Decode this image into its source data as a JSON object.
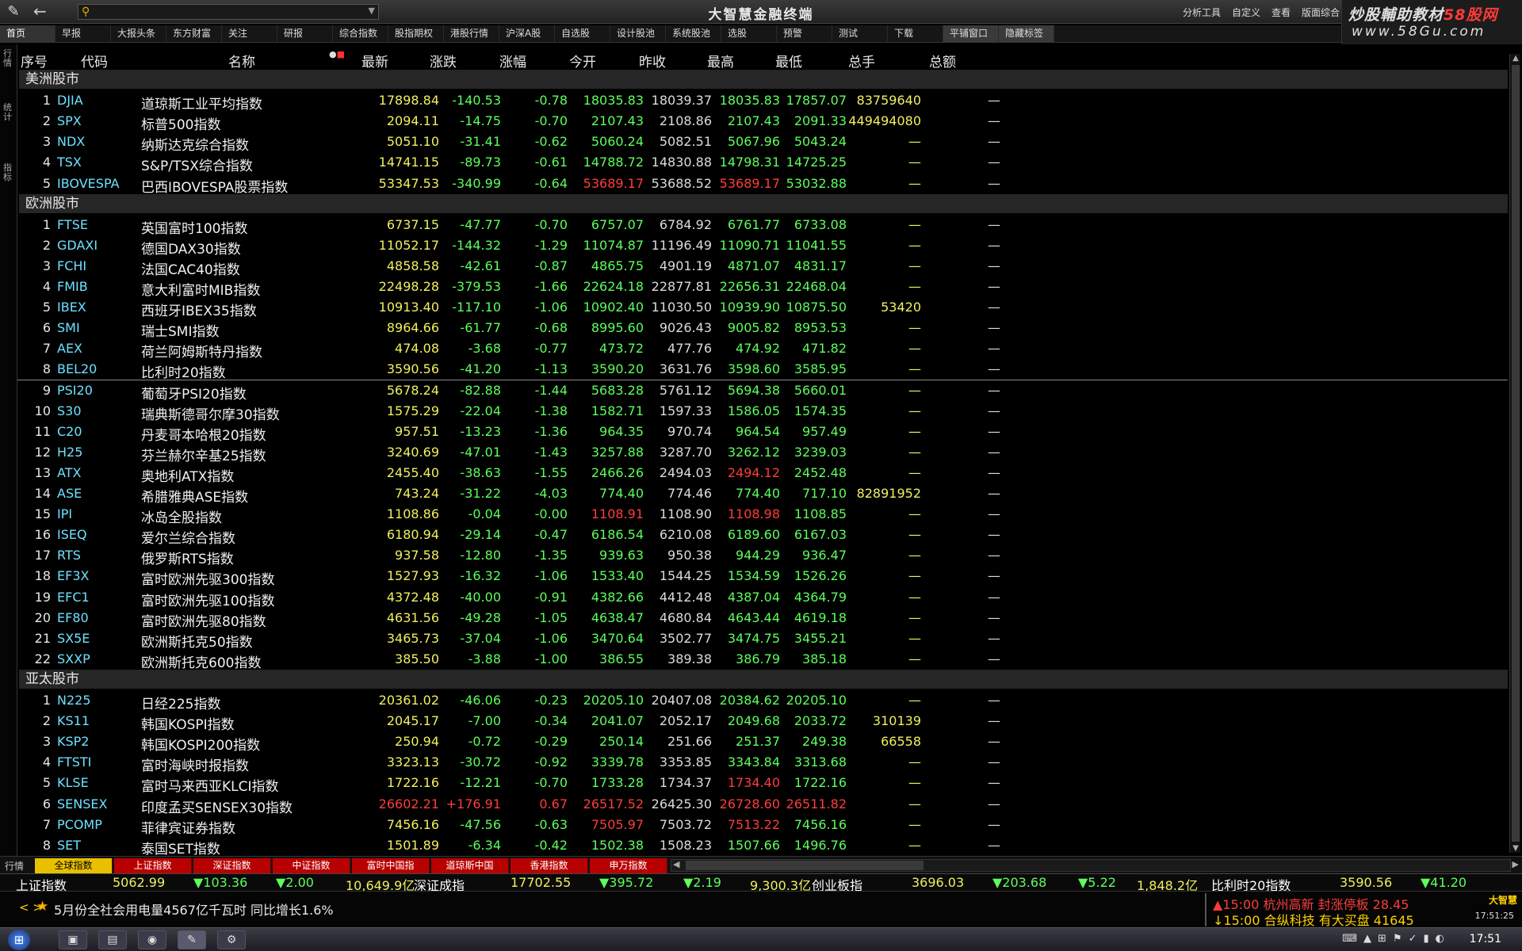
{
  "app": {
    "title": "大智慧金融终端",
    "menu": [
      "分析工具",
      "自定义",
      "查看",
      "版面综合"
    ],
    "watermark_line1": "炒股輔助教材",
    "watermark_brand": "58股网",
    "watermark_line2": "www.58Gu.com"
  },
  "tabs": [
    "首页",
    "早报",
    "大报头条",
    "东方财富",
    "关注",
    "研报",
    "综合指数",
    "股指期权",
    "港股行情",
    "沪深A股",
    "自选股",
    "设计股池",
    "系统股池",
    "选股",
    "预警",
    "测试",
    "下载",
    "平铺窗口",
    "隐藏标签"
  ],
  "left_strip": [
    "行情",
    "统计",
    "指标"
  ],
  "columns": [
    "序号",
    "代码",
    "名称",
    "最新",
    "涨跌",
    "涨幅",
    "今开",
    "昨收",
    "最高",
    "最低",
    "总手",
    "总额"
  ],
  "sections": [
    {
      "title": "美洲股市",
      "rows": [
        {
          "no": "1",
          "code": "DJIA",
          "name": "道琼斯工业平均指数",
          "last": "17898.84",
          "chg": "-140.53",
          "pct": "-0.78",
          "open": "18035.83",
          "prev": "18039.37",
          "high": "18035.83",
          "low": "17857.07",
          "vol": "83759640",
          "amt": "—"
        },
        {
          "no": "2",
          "code": "SPX",
          "name": "标普500指数",
          "last": "2094.11",
          "chg": "-14.75",
          "pct": "-0.70",
          "open": "2107.43",
          "prev": "2108.86",
          "high": "2107.43",
          "low": "2091.33",
          "vol": "449494080",
          "amt": "—"
        },
        {
          "no": "3",
          "code": "NDX",
          "name": "纳斯达克综合指数",
          "last": "5051.10",
          "chg": "-31.41",
          "pct": "-0.62",
          "open": "5060.24",
          "prev": "5082.51",
          "high": "5067.96",
          "low": "5043.24",
          "vol": "—",
          "amt": "—"
        },
        {
          "no": "4",
          "code": "TSX",
          "name": "S&P/TSX综合指数",
          "last": "14741.15",
          "chg": "-89.73",
          "pct": "-0.61",
          "open": "14788.72",
          "prev": "14830.88",
          "high": "14798.31",
          "low": "14725.25",
          "vol": "—",
          "amt": "—"
        },
        {
          "no": "5",
          "code": "IBOVESPA",
          "name": "巴西IBOVESPA股票指数",
          "last": "53347.53",
          "chg": "-340.99",
          "pct": "-0.64",
          "open": "53689.17",
          "prev": "53688.52",
          "high": "53689.17",
          "low": "53032.88",
          "vol": "—",
          "amt": "—",
          "open_up": true,
          "high_up": true
        }
      ]
    },
    {
      "title": "欧洲股市",
      "rows": [
        {
          "no": "1",
          "code": "FTSE",
          "name": "英国富时100指数",
          "last": "6737.15",
          "chg": "-47.77",
          "pct": "-0.70",
          "open": "6757.07",
          "prev": "6784.92",
          "high": "6761.77",
          "low": "6733.08",
          "vol": "—",
          "amt": "—"
        },
        {
          "no": "2",
          "code": "GDAXI",
          "name": "德国DAX30指数",
          "last": "11052.17",
          "chg": "-144.32",
          "pct": "-1.29",
          "open": "11074.87",
          "prev": "11196.49",
          "high": "11090.71",
          "low": "11041.55",
          "vol": "—",
          "amt": "—"
        },
        {
          "no": "3",
          "code": "FCHI",
          "name": "法国CAC40指数",
          "last": "4858.58",
          "chg": "-42.61",
          "pct": "-0.87",
          "open": "4865.75",
          "prev": "4901.19",
          "high": "4871.07",
          "low": "4831.17",
          "vol": "—",
          "amt": "—"
        },
        {
          "no": "4",
          "code": "FMIB",
          "name": "意大利富时MIB指数",
          "last": "22498.28",
          "chg": "-379.53",
          "pct": "-1.66",
          "open": "22624.18",
          "prev": "22877.81",
          "high": "22656.31",
          "low": "22468.04",
          "vol": "—",
          "amt": "—"
        },
        {
          "no": "5",
          "code": "IBEX",
          "name": "西班牙IBEX35指数",
          "last": "10913.40",
          "chg": "-117.10",
          "pct": "-1.06",
          "open": "10902.40",
          "prev": "11030.50",
          "high": "10939.90",
          "low": "10875.50",
          "vol": "53420",
          "amt": "—"
        },
        {
          "no": "6",
          "code": "SMI",
          "name": "瑞士SMI指数",
          "last": "8964.66",
          "chg": "-61.77",
          "pct": "-0.68",
          "open": "8995.60",
          "prev": "9026.43",
          "high": "9005.82",
          "low": "8953.53",
          "vol": "—",
          "amt": "—"
        },
        {
          "no": "7",
          "code": "AEX",
          "name": "荷兰阿姆斯特丹指数",
          "last": "474.08",
          "chg": "-3.68",
          "pct": "-0.77",
          "open": "473.72",
          "prev": "477.76",
          "high": "474.92",
          "low": "471.82",
          "vol": "—",
          "amt": "—"
        },
        {
          "no": "8",
          "code": "BEL20",
          "name": "比利时20指数",
          "last": "3590.56",
          "chg": "-41.20",
          "pct": "-1.13",
          "open": "3590.20",
          "prev": "3631.76",
          "high": "3598.60",
          "low": "3585.95",
          "vol": "—",
          "amt": "—"
        },
        {
          "no": "9",
          "code": "PSI20",
          "name": "葡萄牙PSI20指数",
          "last": "5678.24",
          "chg": "-82.88",
          "pct": "-1.44",
          "open": "5683.28",
          "prev": "5761.12",
          "high": "5694.38",
          "low": "5660.01",
          "vol": "—",
          "amt": "—"
        },
        {
          "no": "10",
          "code": "S30",
          "name": "瑞典斯德哥尔摩30指数",
          "last": "1575.29",
          "chg": "-22.04",
          "pct": "-1.38",
          "open": "1582.71",
          "prev": "1597.33",
          "high": "1586.05",
          "low": "1574.35",
          "vol": "—",
          "amt": "—"
        },
        {
          "no": "11",
          "code": "C20",
          "name": "丹麦哥本哈根20指数",
          "last": "957.51",
          "chg": "-13.23",
          "pct": "-1.36",
          "open": "964.35",
          "prev": "970.74",
          "high": "964.54",
          "low": "957.49",
          "vol": "—",
          "amt": "—"
        },
        {
          "no": "12",
          "code": "H25",
          "name": "芬兰赫尔辛基25指数",
          "last": "3240.69",
          "chg": "-47.01",
          "pct": "-1.43",
          "open": "3257.88",
          "prev": "3287.70",
          "high": "3262.12",
          "low": "3239.03",
          "vol": "—",
          "amt": "—"
        },
        {
          "no": "13",
          "code": "ATX",
          "name": "奥地利ATX指数",
          "last": "2455.40",
          "chg": "-38.63",
          "pct": "-1.55",
          "open": "2466.26",
          "prev": "2494.03",
          "high": "2494.12",
          "low": "2452.48",
          "vol": "—",
          "amt": "—",
          "high_up": true
        },
        {
          "no": "14",
          "code": "ASE",
          "name": "希腊雅典ASE指数",
          "last": "743.24",
          "chg": "-31.22",
          "pct": "-4.03",
          "open": "774.40",
          "prev": "774.46",
          "high": "774.40",
          "low": "717.10",
          "vol": "82891952",
          "amt": "—"
        },
        {
          "no": "15",
          "code": "IPI",
          "name": "冰岛全股指数",
          "last": "1108.86",
          "chg": "-0.04",
          "pct": "-0.00",
          "open": "1108.91",
          "prev": "1108.90",
          "high": "1108.98",
          "low": "1108.85",
          "vol": "—",
          "amt": "—",
          "open_up": true,
          "high_up": true
        },
        {
          "no": "16",
          "code": "ISEQ",
          "name": "爱尔兰综合指数",
          "last": "6180.94",
          "chg": "-29.14",
          "pct": "-0.47",
          "open": "6186.54",
          "prev": "6210.08",
          "high": "6189.60",
          "low": "6167.03",
          "vol": "—",
          "amt": "—"
        },
        {
          "no": "17",
          "code": "RTS",
          "name": "俄罗斯RTS指数",
          "last": "937.58",
          "chg": "-12.80",
          "pct": "-1.35",
          "open": "939.63",
          "prev": "950.38",
          "high": "944.29",
          "low": "936.47",
          "vol": "—",
          "amt": "—"
        },
        {
          "no": "18",
          "code": "EF3X",
          "name": "富时欧洲先驱300指数",
          "last": "1527.93",
          "chg": "-16.32",
          "pct": "-1.06",
          "open": "1533.40",
          "prev": "1544.25",
          "high": "1534.59",
          "low": "1526.26",
          "vol": "—",
          "amt": "—"
        },
        {
          "no": "19",
          "code": "EFC1",
          "name": "富时欧洲先驱100指数",
          "last": "4372.48",
          "chg": "-40.00",
          "pct": "-0.91",
          "open": "4382.66",
          "prev": "4412.48",
          "high": "4387.04",
          "low": "4364.79",
          "vol": "—",
          "amt": "—"
        },
        {
          "no": "20",
          "code": "EF80",
          "name": "富时欧洲先驱80指数",
          "last": "4631.56",
          "chg": "-49.28",
          "pct": "-1.05",
          "open": "4638.47",
          "prev": "4680.84",
          "high": "4643.44",
          "low": "4619.18",
          "vol": "—",
          "amt": "—"
        },
        {
          "no": "21",
          "code": "SX5E",
          "name": "欧洲斯托克50指数",
          "last": "3465.73",
          "chg": "-37.04",
          "pct": "-1.06",
          "open": "3470.64",
          "prev": "3502.77",
          "high": "3474.75",
          "low": "3455.21",
          "vol": "—",
          "amt": "—"
        },
        {
          "no": "22",
          "code": "SXXP",
          "name": "欧洲斯托克600指数",
          "last": "385.50",
          "chg": "-3.88",
          "pct": "-1.00",
          "open": "386.55",
          "prev": "389.38",
          "high": "386.79",
          "low": "385.18",
          "vol": "—",
          "amt": "—"
        }
      ]
    },
    {
      "title": "亚太股市",
      "rows": [
        {
          "no": "1",
          "code": "N225",
          "name": "日经225指数",
          "last": "20361.02",
          "chg": "-46.06",
          "pct": "-0.23",
          "open": "20205.10",
          "prev": "20407.08",
          "high": "20384.62",
          "low": "20205.10",
          "vol": "—",
          "amt": "—"
        },
        {
          "no": "2",
          "code": "KS11",
          "name": "韩国KOSPI指数",
          "last": "2045.17",
          "chg": "-7.00",
          "pct": "-0.34",
          "open": "2041.07",
          "prev": "2052.17",
          "high": "2049.68",
          "low": "2033.72",
          "vol": "310139",
          "amt": "—"
        },
        {
          "no": "3",
          "code": "KSP2",
          "name": "韩国KOSPI200指数",
          "last": "250.94",
          "chg": "-0.72",
          "pct": "-0.29",
          "open": "250.14",
          "prev": "251.66",
          "high": "251.37",
          "low": "249.38",
          "vol": "66558",
          "amt": "—"
        },
        {
          "no": "4",
          "code": "FTSTI",
          "name": "富时海峡时报指数",
          "last": "3323.13",
          "chg": "-30.72",
          "pct": "-0.92",
          "open": "3339.78",
          "prev": "3353.85",
          "high": "3343.84",
          "low": "3313.68",
          "vol": "—",
          "amt": "—"
        },
        {
          "no": "5",
          "code": "KLSE",
          "name": "富时马来西亚KLCI指数",
          "last": "1722.16",
          "chg": "-12.21",
          "pct": "-0.70",
          "open": "1733.28",
          "prev": "1734.37",
          "high": "1734.40",
          "low": "1722.16",
          "vol": "—",
          "amt": "—",
          "high_up": true
        },
        {
          "no": "6",
          "code": "SENSEX",
          "name": "印度孟买SENSEX30指数",
          "last": "26602.21",
          "chg": "+176.91",
          "pct": "0.67",
          "open": "26517.52",
          "prev": "26425.30",
          "high": "26728.60",
          "low": "26511.82",
          "vol": "—",
          "amt": "—",
          "up": true,
          "open_up": true,
          "high_up": true,
          "low_up": true
        },
        {
          "no": "7",
          "code": "PCOMP",
          "name": "菲律宾证券指数",
          "last": "7456.16",
          "chg": "-47.56",
          "pct": "-0.63",
          "open": "7505.97",
          "prev": "7503.72",
          "high": "7513.22",
          "low": "7456.16",
          "vol": "—",
          "amt": "—",
          "open_up": true,
          "high_up": true
        },
        {
          "no": "8",
          "code": "SET",
          "name": "泰国SET指数",
          "last": "1501.89",
          "chg": "-6.34",
          "pct": "-0.42",
          "open": "1502.38",
          "prev": "1508.23",
          "high": "1507.66",
          "low": "1496.76",
          "vol": "—",
          "amt": "—"
        }
      ]
    }
  ],
  "bottom_tabs": {
    "label": "行情",
    "items": [
      "全球指数",
      "上证指数",
      "深证指数",
      "中证指数",
      "富时中国指",
      "道琼斯中国",
      "香港指数",
      "申万指数"
    ]
  },
  "ticker": [
    {
      "name": "上证指数",
      "value": "5062.99",
      "chg": "▼103.36",
      "pct": "▼2.00",
      "amt": "10,649.9亿"
    },
    {
      "name": "深证成指",
      "value": "17702.55",
      "chg": "▼395.72",
      "pct": "▼2.19",
      "amt": "9,300.3亿"
    },
    {
      "name": "创业板指",
      "value": "3696.03",
      "chg": "▼203.68",
      "pct": "▼5.22",
      "amt": "1,848.2亿"
    },
    {
      "name": "比利时20指数",
      "value": "3590.56",
      "chg": "▼41.20",
      "pct": "",
      "amt": ""
    }
  ],
  "news": {
    "nav": "< >",
    "text": "5月份全社会用电量4567亿千瓦时 同比增长1.6%",
    "alert1": "▲15:00 杭州高新 封涨停板 28.45",
    "alert2": "↓15:00 合纵科技 有大买盘 41645",
    "brand": "大智慧",
    "time": "17:51:25"
  },
  "taskbar": {
    "time": "17:51"
  },
  "colors": {
    "up": "#ff3c3c",
    "down": "#5cff5c",
    "code": "#6ee0ff",
    "neutral": "#f0f060",
    "section_bg": "#262626",
    "active_bottom_tab": "#e8c000",
    "bottom_tab": "#b80000"
  }
}
